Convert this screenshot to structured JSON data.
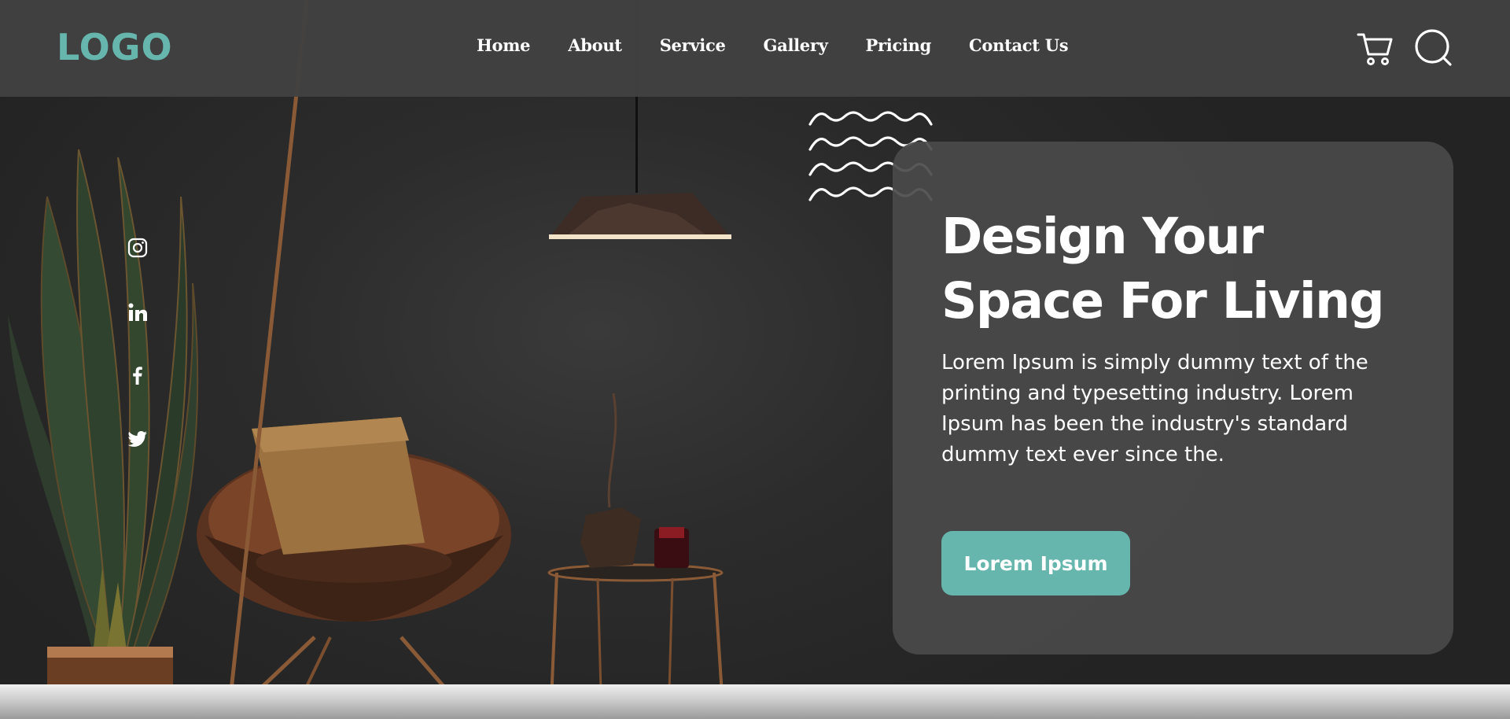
{
  "brand": {
    "logo_text": "LOGO",
    "accent_color": "#66b6ad"
  },
  "nav": {
    "items": [
      {
        "label": "Home"
      },
      {
        "label": "About"
      },
      {
        "label": "Service"
      },
      {
        "label": "Gallery"
      },
      {
        "label": "Pricing"
      },
      {
        "label": "Contact Us"
      }
    ],
    "icons": [
      "cart-icon",
      "search-icon"
    ]
  },
  "social": [
    "instagram-icon",
    "linkedin-icon",
    "facebook-icon",
    "twitter-icon"
  ],
  "hero": {
    "title_line1": "Design Your",
    "title_line2": "Space For Living",
    "description": "Lorem Ipsum is simply dummy text of the printing and typesetting industry. Lorem Ipsum has been the industry's standard dummy text ever since the.",
    "cta_label": "Lorem Ipsum"
  },
  "colors": {
    "navbar_bg": "#424242",
    "card_bg": "#4a4a4a",
    "background": "#2c2c2c"
  }
}
